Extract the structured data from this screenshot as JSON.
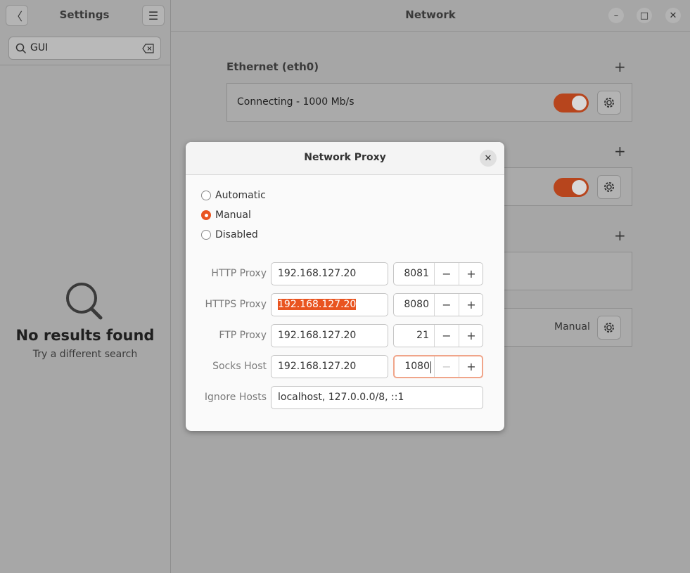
{
  "left": {
    "title": "Settings",
    "back_icon": "chevron-left-icon",
    "menu_icon": "hamburger-menu-icon",
    "search": {
      "value": "GUI",
      "icon": "search-icon",
      "clear_icon": "backspace-clear-icon"
    },
    "empty": {
      "icon": "search-icon",
      "title": "No results found",
      "subtitle": "Try a different search"
    }
  },
  "right": {
    "title": "Network",
    "window_buttons": [
      "minimize-icon",
      "maximize-icon",
      "close-icon"
    ],
    "sections": [
      {
        "title": "Ethernet (eth0)",
        "card_label": "Connecting - 1000 Mb/s",
        "toggle_on": true
      },
      {
        "title": "",
        "card_label": "",
        "toggle_on": true
      },
      {
        "title": "",
        "card_label": ""
      },
      {
        "title": "",
        "status": "Manual"
      }
    ]
  },
  "dialog": {
    "title": "Network Proxy",
    "close_icon": "close-icon",
    "modes": [
      {
        "label": "Automatic",
        "checked": false
      },
      {
        "label": "Manual",
        "checked": true
      },
      {
        "label": "Disabled",
        "checked": false
      }
    ],
    "rows": [
      {
        "label": "HTTP Proxy",
        "host": "192.168.127.20",
        "port": "8081"
      },
      {
        "label": "HTTPS Proxy",
        "host": "192.168.127.20",
        "port": "8080",
        "host_selected": true
      },
      {
        "label": "FTP Proxy",
        "host": "192.168.127.20",
        "port": "21"
      },
      {
        "label": "Socks Host",
        "host": "192.168.127.20",
        "port": "1080",
        "focused": true
      }
    ],
    "ignore_hosts": {
      "label": "Ignore Hosts",
      "value": "localhost, 127.0.0.0/8, ::1"
    }
  },
  "colors": {
    "accent": "#e95420",
    "toggle_dimmed": "#b7451d"
  }
}
